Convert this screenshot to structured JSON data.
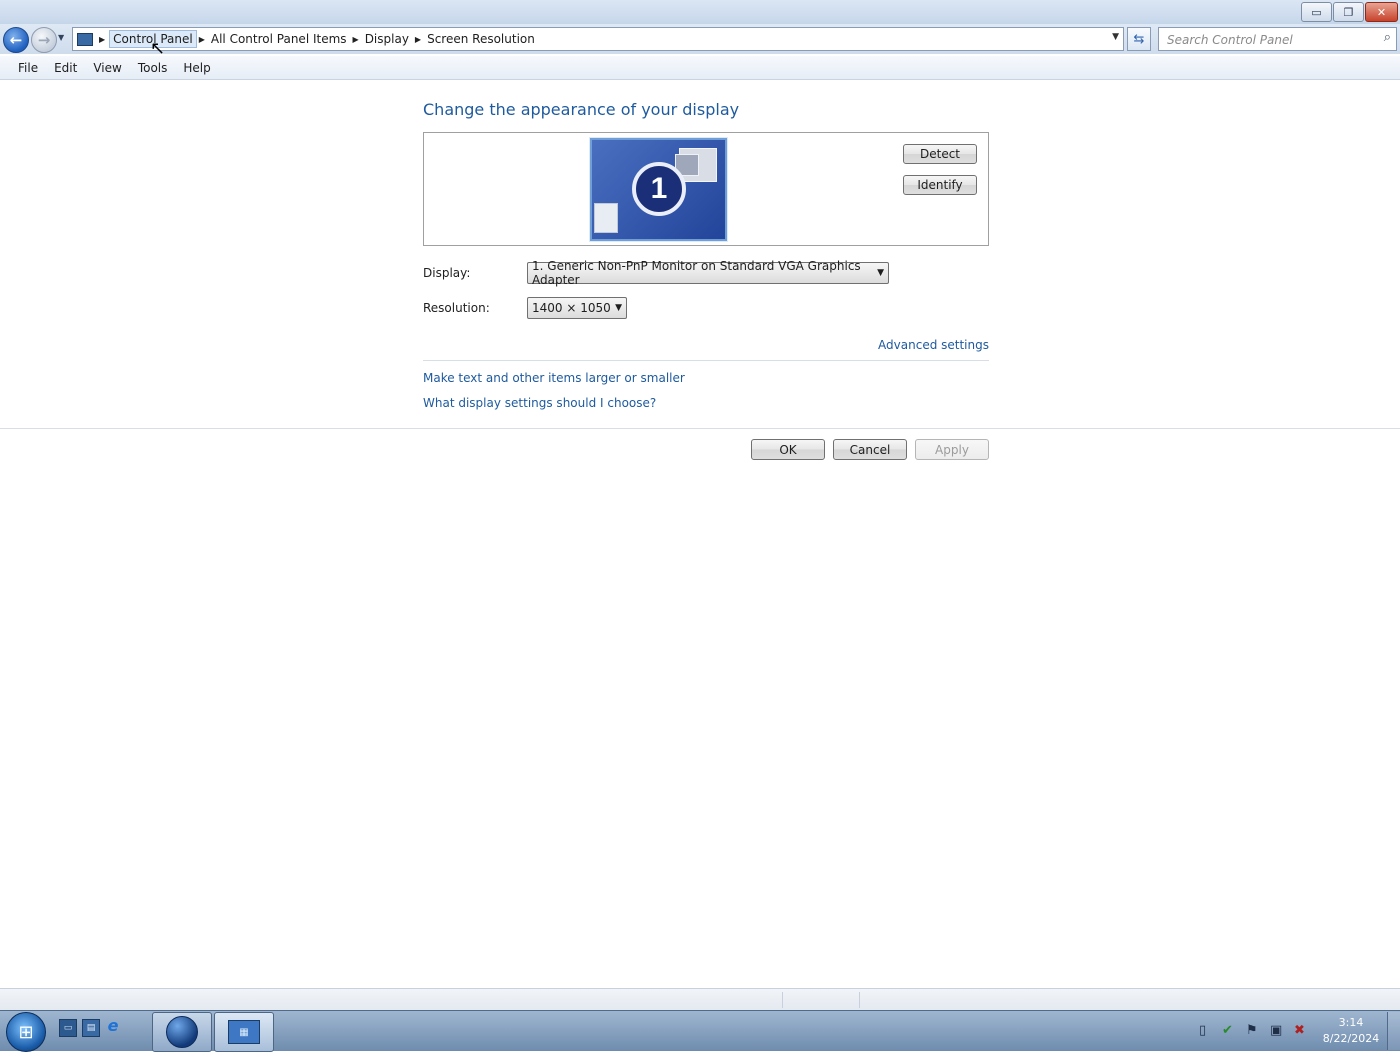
{
  "window": {
    "minimize_label": "▭",
    "restore_label": "❐",
    "close_label": "✕"
  },
  "nav": {
    "back_icon": "arrow-left",
    "forward_icon": "arrow-right",
    "breadcrumbs": [
      "Control Panel",
      "All Control Panel Items",
      "Display",
      "Screen Resolution"
    ],
    "search_placeholder": "Search Control Panel"
  },
  "menu": {
    "items": [
      {
        "label": "File",
        "accel": "F"
      },
      {
        "label": "Edit",
        "accel": "E"
      },
      {
        "label": "View",
        "accel": "V"
      },
      {
        "label": "Tools",
        "accel": "T"
      },
      {
        "label": "Help",
        "accel": "H"
      }
    ]
  },
  "content": {
    "heading": "Change the appearance of your display",
    "monitor_number": "1",
    "detect_label": "Detect",
    "identify_label": "Identify",
    "display_label": "Display:",
    "display_value": "1. Generic Non-PnP Monitor on Standard VGA Graphics Adapter",
    "resolution_label": "Resolution:",
    "resolution_value": "1400 × 1050",
    "advanced_link": "Advanced settings",
    "text_size_link": "Make text and other items larger or smaller",
    "help_link": "What display settings should I choose?",
    "ok_label": "OK",
    "cancel_label": "Cancel",
    "apply_label": "Apply"
  },
  "taskbar": {
    "clock_time": "3:14",
    "clock_date": "8/22/2024"
  },
  "colors": {
    "link": "#1e5a9e",
    "heading": "#1e5a9e",
    "taskbar": "#6f8cae"
  }
}
